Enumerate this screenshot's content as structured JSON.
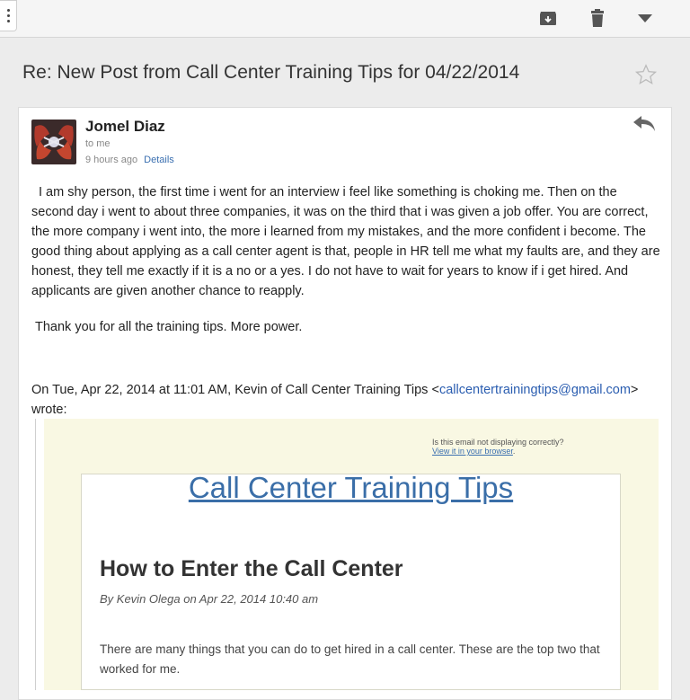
{
  "toolbar": {
    "archive_icon": "archive-icon",
    "delete_icon": "trash-icon",
    "more_icon": "chevron-down-icon",
    "overflow_icon": "vertical-dots-icon"
  },
  "subject": "Re: New Post from Call Center Training Tips for 04/22/2014",
  "message": {
    "sender_name": "Jomel Diaz",
    "recipient": "to me",
    "time": "9 hours ago",
    "details_link": "Details",
    "body": "I am  shy person, the first time i went for an interview i feel like something is choking me. Then on the second day i went to about three companies, it was on the third that i was given a job offer. You are correct, the more company i went into, the more i learned from my mistakes, and the more confident i become. The good thing about applying as a call center agent is that, people in HR tell me what my faults are, and they are honest, they tell me exactly if it is a no or a yes. I do not have to wait for years to know if i get hired. And applicants are given another chance to reapply.",
    "thanks": "Thank you for all the training tips. More power."
  },
  "quoted": {
    "header_prefix": "On Tue, Apr 22, 2014 at 11:01 AM, Kevin of Call Center Training Tips <",
    "email": "callcentertrainingtips@gmail.com",
    "header_suffix": "> wrote:",
    "notice": "Is this email not displaying correctly?",
    "notice_link": "View it in your browser",
    "notice_link_suffix": ".",
    "brand": "Call Center Training Tips",
    "post_title": "How to Enter the Call Center",
    "byline": "By Kevin Olega on Apr 22, 2014 10:40 am",
    "excerpt": "There are many things that you can do to get hired in a call center. These are the top two that worked for me."
  },
  "colors": {
    "link": "#3a6ea8",
    "newsletter_bg": "#f9f8e3",
    "app_bg": "#ececec"
  }
}
